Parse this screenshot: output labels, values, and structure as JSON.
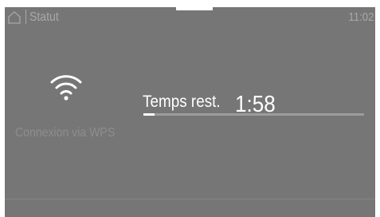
{
  "header": {
    "title": "Statut",
    "clock": "11:02",
    "home_icon": "home-icon"
  },
  "wps": {
    "icon": "wifi-icon",
    "label": "Connexion via WPS"
  },
  "program": {
    "time_label": "Temps rest.",
    "time_value": "1:58",
    "progress_fraction": 0.05
  },
  "colors": {
    "screen_bg": "#767676",
    "text_active": "#ffffff",
    "text_dim": "#a8a8a8",
    "text_disabled": "#8e8e8e",
    "progress_track": "#9c9c9c"
  }
}
